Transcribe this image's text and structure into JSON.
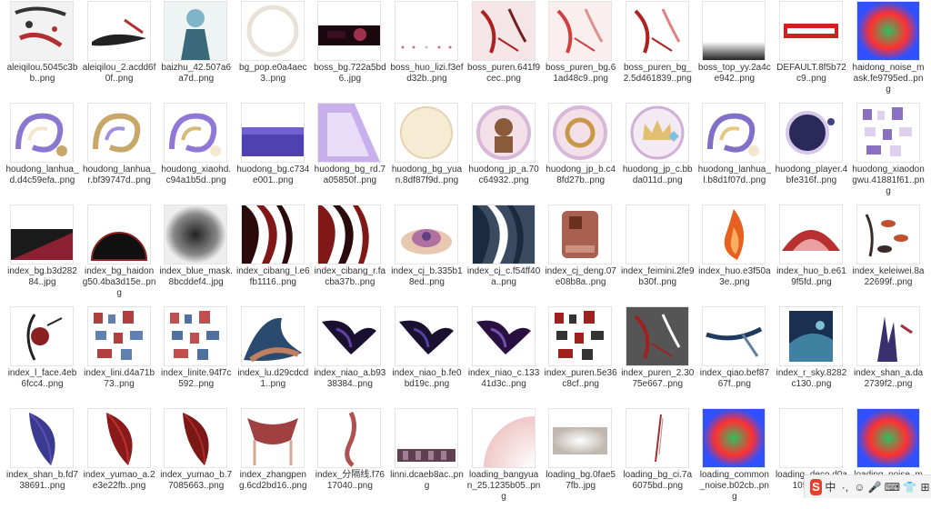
{
  "files": [
    {
      "name": "aleiqilou.5045c3bb..png",
      "icon": "ink-figure-thumb",
      "colors": [
        "#b03030",
        "#333333",
        "#f2f2f2"
      ]
    },
    {
      "name": "aleiqilou_2.acdd6f0f..png",
      "icon": "ink-stroke-thumb",
      "colors": [
        "#222222",
        "#b03030",
        "#ffffff"
      ]
    },
    {
      "name": "baizhu_42.507a6a7d..png",
      "icon": "character-thumb",
      "colors": [
        "#7fb5c8",
        "#eef4f4",
        "#3a6a7a"
      ]
    },
    {
      "name": "bg_pop.e0a4aec3..png",
      "icon": "ring-thumb",
      "colors": [
        "#e8e2d8",
        "#ffffff",
        "#d9d0c0"
      ]
    },
    {
      "name": "boss_bg.722a5bd6..jpg",
      "icon": "dark-banner-thumb",
      "colors": [
        "#3a1020",
        "#a03050",
        "#1a0a10"
      ]
    },
    {
      "name": "boss_huo_lizi.f3efd32b..png",
      "icon": "particles-thumb",
      "colors": [
        "#d07070",
        "#ffffff",
        "#e8b0b0"
      ]
    },
    {
      "name": "boss_puren.641f9cec..png",
      "icon": "red-ink-thumb",
      "colors": [
        "#b02020",
        "#f4e6e6",
        "#702020"
      ]
    },
    {
      "name": "boss_puren_bg.61ad48c9..png",
      "icon": "red-ink-thumb",
      "colors": [
        "#d04040",
        "#fbeeee",
        "#e09090"
      ]
    },
    {
      "name": "boss_puren_bg_2.5d461839..png",
      "icon": "red-ink-thumb",
      "colors": [
        "#b02020",
        "#ffffff",
        "#e08080"
      ]
    },
    {
      "name": "boss_top_yy.2a4ce942..png",
      "icon": "gradient-bar-thumb",
      "colors": [
        "#222222",
        "#ffffff",
        "#888888"
      ]
    },
    {
      "name": "DEFAULT.8f5b72c9..png",
      "icon": "logo-text-thumb",
      "colors": [
        "#d02020",
        "#ffffff",
        "#ffffff"
      ]
    },
    {
      "name": "haidong_noise_mask.fe9795ed..png",
      "icon": "noise-thumb",
      "colors": [
        "#ff3030",
        "#30c060",
        "#3050ff"
      ]
    },
    {
      "name": "houdong_lanhua_d.d4c59efa..png",
      "icon": "swirl-thumb",
      "colors": [
        "#8a78d0",
        "#f2e6cc",
        "#c8a868"
      ]
    },
    {
      "name": "houdong_lanhua_r.bf39747d..png",
      "icon": "swirl-thumb",
      "colors": [
        "#c8a868",
        "#a090e0",
        "#ffffff"
      ]
    },
    {
      "name": "houdong_xiaohd.c94a1b5d..png",
      "icon": "swirl-thumb",
      "colors": [
        "#9078d8",
        "#d8b878",
        "#f4e8d0"
      ]
    },
    {
      "name": "huodong_bg.c734e001..png",
      "icon": "purple-block-thumb",
      "colors": [
        "#5040b0",
        "#7060d0",
        "#3a2e90"
      ]
    },
    {
      "name": "huodong_bg_rd.7a05850f..png",
      "icon": "purple-fold-thumb",
      "colors": [
        "#c8b0ec",
        "#e8dcf8",
        "#a088d8"
      ]
    },
    {
      "name": "huodong_bg_yuan.8df87f9d..png",
      "icon": "cream-circle-thumb",
      "colors": [
        "#f6ecd4",
        "#e4d2b0",
        "#ffffff"
      ]
    },
    {
      "name": "huodong_jp_a.70c64932..png",
      "icon": "badge-portrait-thumb",
      "colors": [
        "#d8b8d8",
        "#8a5a3a",
        "#f4e0e8"
      ]
    },
    {
      "name": "huodong_jp_b.c48fd27b..png",
      "icon": "badge-horn-thumb",
      "colors": [
        "#d8b8d8",
        "#c89848",
        "#f4e0e8"
      ]
    },
    {
      "name": "huodong_jp_c.bbda011d..png",
      "icon": "badge-crown-thumb",
      "colors": [
        "#d0b0d8",
        "#e0c070",
        "#80c0e0"
      ]
    },
    {
      "name": "huodong_lanhua_l.b8d1f07d..png",
      "icon": "swirl-thumb",
      "colors": [
        "#8070c8",
        "#e8c880",
        "#f2e6cc"
      ]
    },
    {
      "name": "huodong_player.4bfe316f..png",
      "icon": "dark-circle-thumb",
      "colors": [
        "#2a2a5a",
        "#d8c8e8",
        "#404080"
      ]
    },
    {
      "name": "huodong_xiaodongwu.41881f61..png",
      "icon": "sprite-sheet-thumb",
      "colors": [
        "#8a70c0",
        "#e0d0f0",
        "#c0a060"
      ]
    },
    {
      "name": "index_bg.b3d28284..jpg",
      "icon": "diagonal-bg-thumb",
      "colors": [
        "#1a1a1a",
        "#8a2030",
        "#3a1a1a"
      ]
    },
    {
      "name": "index_bg_haidong50.4ba3d15e..png",
      "icon": "half-circle-thumb",
      "colors": [
        "#111111",
        "#8a2020",
        "#e8d8d8"
      ]
    },
    {
      "name": "index_blue_mask.8bcddef4..jpg",
      "icon": "cloud-mask-thumb",
      "colors": [
        "#222222",
        "#888888",
        "#eeeeee"
      ]
    },
    {
      "name": "index_cibang_l.e6fb1116..png",
      "icon": "dark-wave-thumb",
      "colors": [
        "#2a0a0a",
        "#801818",
        "#ffffff"
      ]
    },
    {
      "name": "index_cibang_r.facba37b..png",
      "icon": "dark-wave-thumb",
      "colors": [
        "#801818",
        "#2a0a0a",
        "#ffffff"
      ]
    },
    {
      "name": "index_cj_b.335b18ed..png",
      "icon": "lotus-thumb",
      "colors": [
        "#b070a0",
        "#e8c8b0",
        "#604080"
      ]
    },
    {
      "name": "index_cj_c.f54ff40a..png",
      "icon": "dark-wave-thumb",
      "colors": [
        "#1a2a40",
        "#ffffff",
        "#3a4a60"
      ]
    },
    {
      "name": "index_cj_deng.07e08b8a..png",
      "icon": "lantern-thumb",
      "colors": [
        "#a86050",
        "#6a3020",
        "#d09080"
      ]
    },
    {
      "name": "index_feimini.2fe9b30f..png",
      "icon": "blank-thumb",
      "colors": [
        "#ffffff",
        "#fafafa",
        "#f0f0f0"
      ]
    },
    {
      "name": "index_huo.e3f50a3e..png",
      "icon": "flame-thumb",
      "colors": [
        "#e86020",
        "#f8b060",
        "#ffffff"
      ]
    },
    {
      "name": "index_huo_b.e619f5fd..png",
      "icon": "red-dome-thumb",
      "colors": [
        "#b83030",
        "#e8a0a0",
        "#ffffff"
      ]
    },
    {
      "name": "index_keleiwei.8a22699f..png",
      "icon": "leaves-thumb",
      "colors": [
        "#c05030",
        "#3a2a2a",
        "#ffffff"
      ]
    },
    {
      "name": "index_l_face.4eb6fcc4..png",
      "icon": "face-thumb",
      "colors": [
        "#8a2020",
        "#222222",
        "#ffffff"
      ]
    },
    {
      "name": "index_lini.d4a71b73..png",
      "icon": "sprite-sheet-thumb",
      "colors": [
        "#b04040",
        "#6080b0",
        "#ffffff"
      ]
    },
    {
      "name": "index_linite.94f7c592..png",
      "icon": "sprite-sheet-thumb",
      "colors": [
        "#c05050",
        "#5070a0",
        "#ffffff"
      ]
    },
    {
      "name": "index_lu.d29cdcd1..png",
      "icon": "wave-hat-thumb",
      "colors": [
        "#2a4a70",
        "#c08060",
        "#ffffff"
      ]
    },
    {
      "name": "index_niao_a.b9338384..png",
      "icon": "bird-thumb",
      "colors": [
        "#1a1030",
        "#6040a0",
        "#ffffff"
      ]
    },
    {
      "name": "index_niao_b.fe0bd19c..png",
      "icon": "bird-thumb",
      "colors": [
        "#1a1030",
        "#5040a0",
        "#ffffff"
      ]
    },
    {
      "name": "index_niao_c.13341d3c..png",
      "icon": "bird-thumb",
      "colors": [
        "#2a1040",
        "#7050b0",
        "#ffffff"
      ]
    },
    {
      "name": "index_puren.5e36c8cf..png",
      "icon": "sprite-sheet-thumb",
      "colors": [
        "#a02020",
        "#333333",
        "#ffffff"
      ]
    },
    {
      "name": "index_puren_2.3075e667..png",
      "icon": "red-ink-thumb",
      "colors": [
        "#a02020",
        "#555555",
        "#ffffff"
      ]
    },
    {
      "name": "index_qiao.bef8767f..png",
      "icon": "bridge-thumb",
      "colors": [
        "#203a60",
        "#6080a0",
        "#ffffff"
      ]
    },
    {
      "name": "index_r_sky.8282c130..png",
      "icon": "sky-thumb",
      "colors": [
        "#1a3050",
        "#4080a0",
        "#80c0d0"
      ]
    },
    {
      "name": "index_shan_a.da2739f2..png",
      "icon": "mountain-thumb",
      "colors": [
        "#3a3070",
        "#a03040",
        "#ffffff"
      ]
    },
    {
      "name": "index_shan_b.fd738691..png",
      "icon": "feather-thumb",
      "colors": [
        "#3a3a90",
        "#6050b0",
        "#ffffff"
      ]
    },
    {
      "name": "index_yumao_a.2e3e22fb..png",
      "icon": "feather-thumb",
      "colors": [
        "#8a1a1a",
        "#c03030",
        "#ffffff"
      ]
    },
    {
      "name": "index_yumao_b.77085663..png",
      "icon": "feather-thumb",
      "colors": [
        "#7a1818",
        "#b02828",
        "#ffffff"
      ]
    },
    {
      "name": "index_zhangpeng.6cd2bd16..png",
      "icon": "tent-thumb",
      "colors": [
        "#a04040",
        "#d8a890",
        "#ffffff"
      ]
    },
    {
      "name": "index_分隔线.f7617040..png",
      "icon": "divider-thumb",
      "colors": [
        "#b05050",
        "#e0b0a0",
        "#ffffff"
      ]
    },
    {
      "name": "linni.dcaeb8ac..png",
      "icon": "sprite-strip-thumb",
      "colors": [
        "#604050",
        "#ffffff",
        "#a08090"
      ]
    },
    {
      "name": "loading_bangyuan_25.1235b05..png",
      "icon": "glow-circle-thumb",
      "colors": [
        "#f0c8c8",
        "#ffffff",
        "#e8a0a0"
      ]
    },
    {
      "name": "loading_bg.0fae57fb..jpg",
      "icon": "light-burst-thumb",
      "colors": [
        "#ffffff",
        "#e0d8d0",
        "#c0b8b0"
      ]
    },
    {
      "name": "loading_bg_ci.7a6075bd..png",
      "icon": "thin-line-thumb",
      "colors": [
        "#a03030",
        "#ffffff",
        "#d08080"
      ]
    },
    {
      "name": "loading_common_noise.b02cb..png",
      "icon": "noise-thumb",
      "colors": [
        "#e02060",
        "#20c040",
        "#4040e0"
      ]
    },
    {
      "name": "loading_deco.d0a105f..png",
      "icon": "blank-thumb",
      "colors": [
        "#ffffff",
        "#fafafa",
        "#f0f0f0"
      ]
    },
    {
      "name": "loading_noise_mask.e3e59f4..png",
      "icon": "noise-thumb",
      "colors": [
        "#e040a0",
        "#40e0a0",
        "#4040e0"
      ]
    }
  ],
  "tray": {
    "ime_logo": "S",
    "lang": "中",
    "items": [
      "·,",
      "☺",
      "🎤",
      "⌨",
      "👕",
      "⊞"
    ]
  }
}
